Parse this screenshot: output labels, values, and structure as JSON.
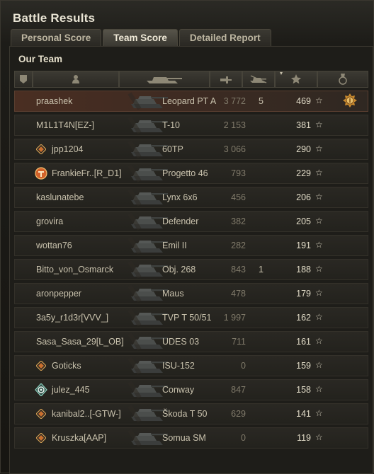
{
  "window": {
    "title": "Battle Results"
  },
  "tabs": [
    {
      "label": "Personal Score",
      "active": false
    },
    {
      "label": "Team Score",
      "active": true
    },
    {
      "label": "Detailed Report",
      "active": false
    }
  ],
  "team": {
    "title": "Our Team"
  },
  "columns": [
    {
      "icon": "rank-chevron-icon"
    },
    {
      "icon": "player-icon"
    },
    {
      "icon": "tank-icon"
    },
    {
      "icon": "damage-icon"
    },
    {
      "icon": "kills-icon"
    },
    {
      "icon": "experience-star-icon",
      "sorted": true
    },
    {
      "icon": "medal-icon"
    }
  ],
  "colors": {
    "self_row": "#4a2e22",
    "accent": "#d8a53a"
  },
  "rows": [
    {
      "name": "praashek",
      "vehicle": "Leopard PT A",
      "damage": "3 772",
      "kills": "5",
      "xp": "469",
      "star": "☆",
      "badge": "",
      "medal": true,
      "self": true
    },
    {
      "name": "M1L1T4N[EZ-]",
      "vehicle": "T-10",
      "damage": "2 153",
      "kills": "",
      "xp": "381",
      "star": "☆",
      "badge": ""
    },
    {
      "name": "jpp1204",
      "vehicle": "60TP",
      "damage": "3 066",
      "kills": "",
      "xp": "290",
      "star": "☆",
      "badge": "diamond"
    },
    {
      "name": "FrankieFr..[R_D1]",
      "vehicle": "Progetto 46",
      "damage": "793",
      "kills": "",
      "xp": "229",
      "star": "☆",
      "badge": "orange"
    },
    {
      "name": "kaslunatebe",
      "vehicle": "Lynx 6x6",
      "damage": "456",
      "kills": "",
      "xp": "206",
      "star": "☆",
      "badge": ""
    },
    {
      "name": "grovira",
      "vehicle": "Defender",
      "damage": "382",
      "kills": "",
      "xp": "205",
      "star": "☆",
      "badge": ""
    },
    {
      "name": "wottan76",
      "vehicle": "Emil II",
      "damage": "282",
      "kills": "",
      "xp": "191",
      "star": "☆",
      "badge": ""
    },
    {
      "name": "Bitto_von_Osmarck",
      "vehicle": "Obj. 268",
      "damage": "843",
      "kills": "1",
      "xp": "188",
      "star": "☆",
      "badge": ""
    },
    {
      "name": "aronpepper",
      "vehicle": "Maus",
      "damage": "478",
      "kills": "",
      "xp": "179",
      "star": "☆",
      "badge": ""
    },
    {
      "name": "3a5y_r1d3r[VVV_]",
      "vehicle": "TVP T 50/51",
      "damage": "1 997",
      "kills": "",
      "xp": "162",
      "star": "☆",
      "badge": ""
    },
    {
      "name": "Sasa_Sasa_29[L_OB]",
      "vehicle": "UDES 03",
      "damage": "711",
      "kills": "",
      "xp": "161",
      "star": "☆",
      "badge": ""
    },
    {
      "name": "Goticks",
      "vehicle": "ISU-152",
      "damage": "0",
      "kills": "",
      "xp": "159",
      "star": "☆",
      "badge": "diamond"
    },
    {
      "name": "julez_445",
      "vehicle": "Conway",
      "damage": "847",
      "kills": "",
      "xp": "158",
      "star": "☆",
      "badge": "green"
    },
    {
      "name": "kanibal2..[-GTW-]",
      "vehicle": "Škoda T 50",
      "damage": "629",
      "kills": "",
      "xp": "141",
      "star": "☆",
      "badge": "diamond"
    },
    {
      "name": "Kruszka[AAP]",
      "vehicle": "Somua SM",
      "damage": "0",
      "kills": "",
      "xp": "119",
      "star": "☆",
      "badge": "diamond"
    }
  ]
}
